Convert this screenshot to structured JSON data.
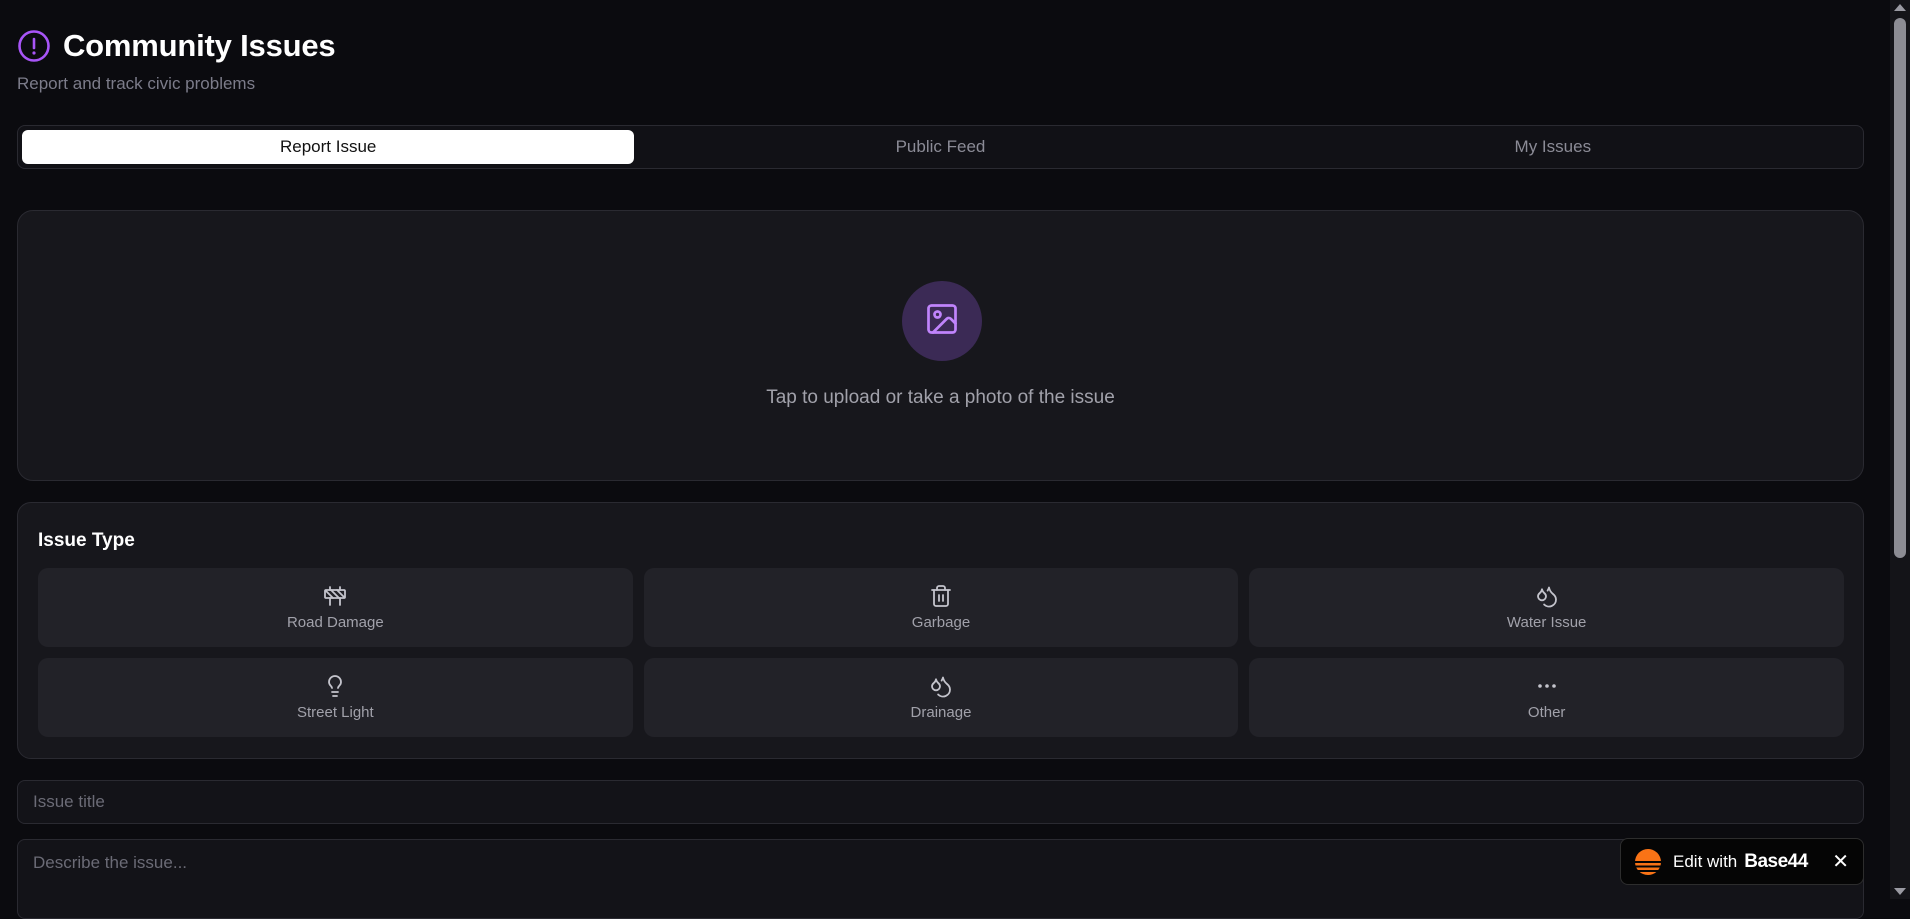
{
  "header": {
    "title": "Community Issues",
    "subtitle": "Report and track civic problems",
    "icon": "alert-circle-icon",
    "accent_color": "#a855f7"
  },
  "tabs": [
    {
      "label": "Report Issue",
      "active": true
    },
    {
      "label": "Public Feed",
      "active": false
    },
    {
      "label": "My Issues",
      "active": false
    }
  ],
  "upload": {
    "icon": "image-icon",
    "text": "Tap to upload or take a photo of the issue"
  },
  "issue_type": {
    "heading": "Issue Type",
    "options": [
      {
        "label": "Road Damage",
        "icon": "construction-barrier-icon"
      },
      {
        "label": "Garbage",
        "icon": "trash-icon"
      },
      {
        "label": "Water Issue",
        "icon": "droplets-icon"
      },
      {
        "label": "Street Light",
        "icon": "lightbulb-icon"
      },
      {
        "label": "Drainage",
        "icon": "droplets-icon"
      },
      {
        "label": "Other",
        "icon": "more-horizontal-icon"
      }
    ]
  },
  "form": {
    "title_placeholder": "Issue title",
    "description_placeholder": "Describe the issue..."
  },
  "badge": {
    "prefix": "Edit with",
    "brand": "Base44",
    "close": "✕",
    "logo_color": "#f97316"
  }
}
